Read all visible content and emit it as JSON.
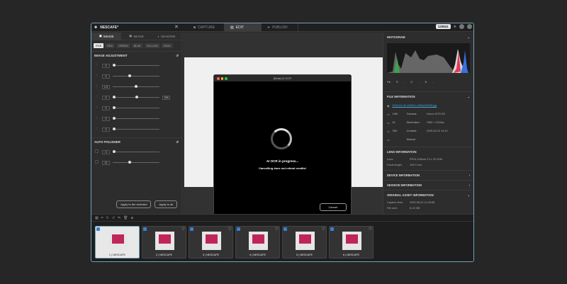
{
  "titlebar": {
    "project": "NESCAFE*",
    "tabs": [
      "CAPTURE",
      "EDIT",
      "PUBLISH"
    ],
    "active_tab": "EDIT",
    "credits": "125841"
  },
  "left": {
    "tabs": [
      "IMAGE",
      "SHADOW"
    ],
    "chips": [
      "RGB",
      "RED",
      "GREEN",
      "BLUE",
      "YELLOW",
      "GRAY"
    ],
    "image_adjustment": "IMAGE ADJUSTMENT",
    "sliders": [
      {
        "icon": "triangle-icon",
        "value": "0",
        "knob": 0.0
      },
      {
        "icon": "brightness-icon",
        "value": "0",
        "knob": 0.35
      },
      {
        "icon": "contrast-icon",
        "value": "1.0",
        "knob": 0.5
      },
      {
        "icon": "curve-icon",
        "value": "0",
        "knob": 0.0,
        "extra": "255",
        "knob2": 0.52
      },
      {
        "icon": "vibrance-icon",
        "value": "0",
        "knob": 0.0
      },
      {
        "icon": "drop-icon",
        "value": "0",
        "knob": 0.0
      },
      {
        "icon": "half-circle-icon",
        "value": "0",
        "knob": 0.0
      }
    ],
    "auto_polisher": "AUTO POLISHER",
    "polisher_sliders": [
      {
        "value": "0",
        "knob": 0.0
      },
      {
        "value": "11",
        "knob": 0.35
      }
    ],
    "apply_selected": "Apply to the selected",
    "apply_all": "Apply to all"
  },
  "modal": {
    "title": "[Beta] AI OCR",
    "progress": "AI OCR in progress...",
    "note": "Cancelling does not refund credits!",
    "cancel": "Cancel"
  },
  "right": {
    "histogram": "HISTOGRAM",
    "hist_labels": [
      "R",
      "G",
      "B"
    ],
    "file_info": "FILE INFORMATION",
    "file_link": "2025-04-30-104531-e39ba93ef38.jpg",
    "rows": [
      {
        "k": "1/60",
        "k2": "Camera:",
        "v": "Canon EOS R5"
      },
      {
        "k": "f/1",
        "k2": "Dimension:",
        "v": "7680 × 4320px"
      },
      {
        "k": "250",
        "k2": "Created:",
        "v": "2025-05-20 14:42"
      },
      {
        "k": "",
        "k2": "Manual",
        "v": ""
      }
    ],
    "lens_info": "LENS INFORMATION",
    "lens_rows": [
      {
        "k": "Lens:",
        "v": "RF24-105mm F4 L IS USM"
      },
      {
        "k": "Focal length:",
        "v": "105.0 mm"
      }
    ],
    "device_info": "DEVICE INFORMATION",
    "session_info": "SESSION INFORMATION",
    "original_info": "ORIGINAL ASSET INFORMATION",
    "orig_rows": [
      {
        "k": "Capture time:",
        "v": "2025-05-20 14:43:56"
      },
      {
        "k": "File size:",
        "v": "8.13 MB"
      }
    ]
  },
  "thumbs": [
    "1 | NESCAFE",
    "2 | NESCAFE",
    "3 | NESCAFE",
    "4 | NESCAFE",
    "5 | NESCAFE",
    "6 | NESCAFE"
  ]
}
